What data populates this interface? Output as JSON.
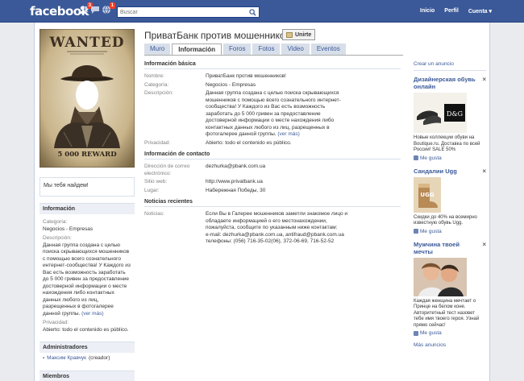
{
  "topbar": {
    "logo": "facebook",
    "badge_friends": "3",
    "badge_notifications": "1",
    "search_placeholder": "Buscar",
    "nav": [
      "Inicio",
      "Perfil",
      "Cuenta ▾"
    ]
  },
  "group": {
    "title": "ПриватБанк против мошенников!",
    "join_label": "Unirte",
    "poster_wanted": "WANTED",
    "poster_reward": "5 000 REWARD"
  },
  "tabs": [
    {
      "label": "Muro"
    },
    {
      "label": "Información"
    },
    {
      "label": "Foros"
    },
    {
      "label": "Fotos"
    },
    {
      "label": "Video"
    },
    {
      "label": "Eventos"
    }
  ],
  "status": "Мы тебя найдем!",
  "left_info": {
    "heading": "Información",
    "category_label": "Categoría:",
    "category_value": "Negocios - Empresas",
    "desc_label": "Descripción:",
    "desc_value": "Данная группа создана с целью поиска скрывающихся мошенников с помощью всего сознательного интернет-сообщества! У Каждого из Вас есть возможность заработать до 5 000 гривен за предоставление достоверной информации о месте нахождения либо контактных данных любого из лиц, разрещенных в фотогалерее данной группы.",
    "see_more": "(ver más)",
    "privacy_label": "Privacidad:",
    "privacy_value": "Abierto: todo el contenido es público."
  },
  "admins": {
    "heading": "Administradores",
    "name": "Максим Кравчук",
    "role": "(creador)"
  },
  "members": {
    "heading": "Miembros"
  },
  "basic_info": {
    "heading": "Información básica",
    "name_label": "Nombre:",
    "name_value": "ПриватБанк против мошенников!",
    "category_label": "Categoría:",
    "category_value": "Negocios - Empresas",
    "desc_label": "Descripción:",
    "desc_value": "Данная группа создана с целью поиска скрывающихся мошенников с помощью всего сознательного интернет-сообщества! У Каждого из Вас есть возможность заработать до 5 000 гривен за предоставление достоверной информации о месте нахождения либо контактных данных любого из лиц, разрещенных в фотогалерее данной группы.",
    "see_more": "(ver más)",
    "privacy_label": "Privacidad:",
    "privacy_value": "Abierto: todo el contenido es público."
  },
  "contact_info": {
    "heading": "Información de contacto",
    "email_label": "Dirección de correo electrónico:",
    "email_value": "dezhurka@pbank.com.ua",
    "web_label": "Sitio web:",
    "web_value": "http://www.privatbank.ua",
    "place_label": "Lugar:",
    "place_value": "Набережная Победы, 30"
  },
  "news": {
    "heading": "Noticias recientes",
    "label": "Noticias:",
    "line1": "Если Вы в Галерее мошенников заметли знакомое лицо и обладаете информацией о его местонахождении, пожалуйста, сообщите по указанным ниже контактам:",
    "line2": "e-mail: dezhurka@pbank.com.ua, antifraud@pbank.com.ua",
    "line3": "телефоны: (056) 716-35-02(06), 372-06-69, 716-52-52"
  },
  "ads": {
    "create": "Crear un anuncio",
    "items": [
      {
        "title": "Дизайнерская обувь онлайн",
        "text": "Новые коллекции обуви на Boutique.ru. Доставка по всей России! SALE 50%",
        "like": "Me gusta"
      },
      {
        "title": "Сандалии Ugg",
        "text": "Скидки до 40% на всемирно известную обувь Ugg.",
        "like": "Me gusta"
      },
      {
        "title": "Мужчина твоей мечты",
        "text": "Каждая женщина мечтает о Принце на белом коне. Авторитетный тест назовет тебе имя твоего героя. Узнай прямо сейчас!",
        "like": "Me gusta"
      }
    ],
    "more": "Más anuncios"
  }
}
